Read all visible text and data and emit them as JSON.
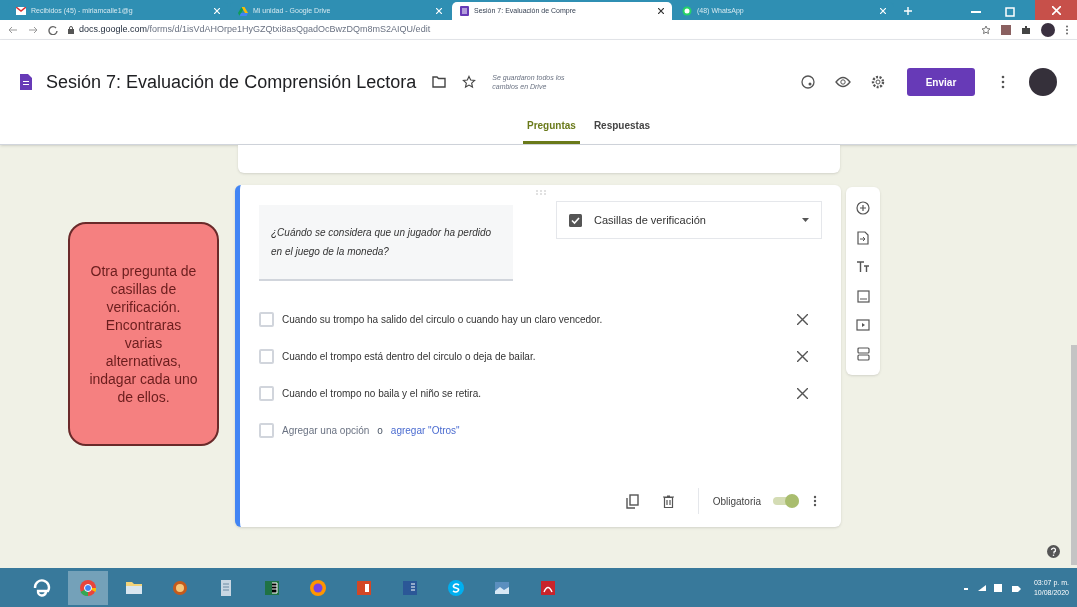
{
  "browser": {
    "tabs": [
      {
        "kind": "gmail",
        "title": "Recibidos (45) - miriamcalle1@g",
        "selected": false
      },
      {
        "kind": "drive",
        "title": "Mi unidad - Google Drive",
        "selected": false
      },
      {
        "kind": "forms",
        "title": "Sesión 7: Evaluación de Compre",
        "selected": true
      },
      {
        "kind": "whatsapp",
        "title": "(48) WhatsApp",
        "selected": false
      }
    ],
    "url_host": "docs.google.com",
    "url_path": "/forms/d/1isVdAHOrpe1HyGZQtxi8asQgadOcBwzDQm8mS2AIQU/edit"
  },
  "form": {
    "title": "Sesión 7: Evaluación de Comprensión Lectora",
    "save_status": "Se guardaron todos los cambios en Drive",
    "send_button": "Enviar",
    "tabs": [
      {
        "label": "Preguntas",
        "selected": true
      },
      {
        "label": "Respuestas",
        "selected": false
      }
    ],
    "question": {
      "text": "¿Cuándo se considera que un jugador ha perdido en el juego de la moneda?",
      "type_label": "Casillas de verificación",
      "options": [
        {
          "text": "Cuando su trompo ha salido del circulo o cuando hay un claro vencedor.",
          "checked": false
        },
        {
          "text": "Cuando el trompo está dentro del circulo o deja de bailar.",
          "checked": false
        },
        {
          "text": "Cuando el trompo no baila y el niño se retira.",
          "checked": false
        }
      ],
      "add_option": "Agregar una opción",
      "add_checked": false,
      "add_or": "o",
      "add_other": "agregar \"Otros\"",
      "required_label": "Obligatoria",
      "required": true
    }
  },
  "callout": {
    "text": "Otra pregunta de casillas de verificación. Encontraras varias alternativas, indagar cada uno de ellos."
  },
  "taskbar": {
    "apps": [
      {
        "kind": "ie",
        "selected": false
      },
      {
        "kind": "chrome",
        "selected": true
      },
      {
        "kind": "folder",
        "selected": false
      },
      {
        "kind": "paint",
        "selected": false
      },
      {
        "kind": "doc",
        "selected": false
      },
      {
        "kind": "excel",
        "selected": false
      },
      {
        "kind": "firefox",
        "selected": false
      },
      {
        "kind": "powerpoint",
        "selected": false
      },
      {
        "kind": "word",
        "selected": false
      },
      {
        "kind": "skype",
        "selected": false
      },
      {
        "kind": "photo",
        "selected": false
      },
      {
        "kind": "acrobat",
        "selected": false
      }
    ],
    "time": "03:07 p. m.",
    "date": "10/08/2020"
  }
}
